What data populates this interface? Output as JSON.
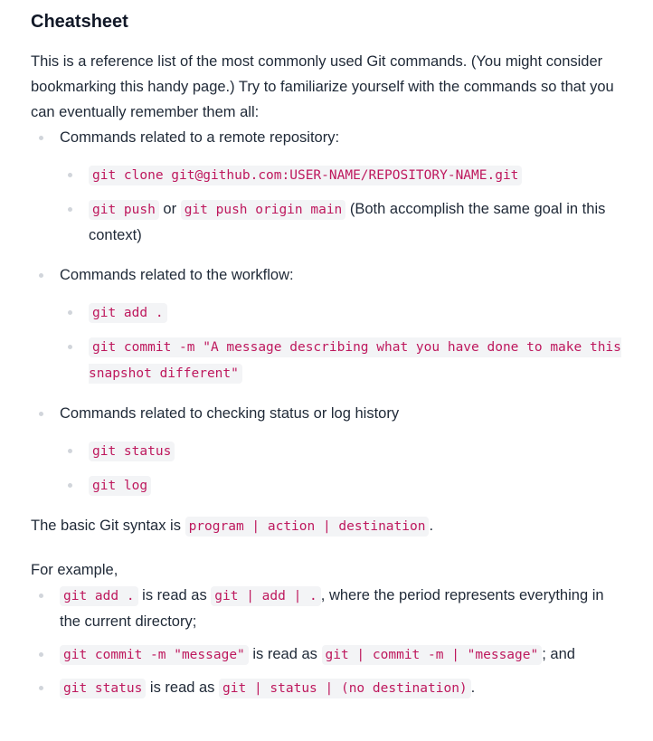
{
  "heading": "Cheatsheet",
  "intro": "This is a reference list of the most commonly used Git commands. (You might consider bookmarking this handy page.) Try to familiarize yourself with the commands so that you can eventually remember them all:",
  "sections": [
    {
      "title": "Commands related to a remote repository:",
      "items": [
        {
          "code1": "git clone git@github.com:USER-NAME/REPOSITORY-NAME.git"
        },
        {
          "code1": "git push",
          "middle": " or ",
          "code2": "git push origin main",
          "after": " (Both accomplish the same goal in this context)"
        }
      ]
    },
    {
      "title": "Commands related to the workflow:",
      "items": [
        {
          "code1": "git add ."
        },
        {
          "code1": "git commit -m \"A message describing what you have done to make this snapshot different\""
        }
      ]
    },
    {
      "title": "Commands related to checking status or log history",
      "items": [
        {
          "code1": "git status"
        },
        {
          "code1": "git log"
        }
      ]
    }
  ],
  "syntax": {
    "before": "The basic Git syntax is ",
    "code": "program | action | destination",
    "after": "."
  },
  "example_lead": "For example,",
  "examples": [
    {
      "code1": "git add .",
      "middle": " is read as ",
      "code2": "git | add | .",
      "after": ", where the period represents everything in the current directory;"
    },
    {
      "code1": "git commit -m \"message\"",
      "middle": " is read as ",
      "code2": "git | commit -m | \"message\"",
      "after": "; and"
    },
    {
      "code1": "git status",
      "middle": " is read as ",
      "code2": "git | status | (no destination)",
      "after": "."
    }
  ]
}
